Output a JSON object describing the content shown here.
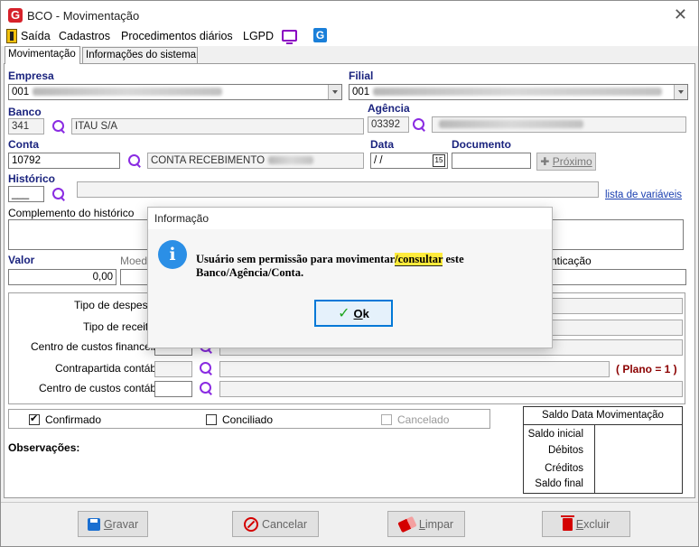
{
  "window": {
    "title": "BCO - Movimentação",
    "logo_letter": "G",
    "close_glyph": "✕"
  },
  "menu": {
    "items": [
      "Saída",
      "Cadastros",
      "Procedimentos diários",
      "LGPD"
    ],
    "g_badge": "G"
  },
  "tabs": [
    {
      "label": "Movimentação"
    },
    {
      "label": "Informações do sistema"
    }
  ],
  "form": {
    "empresa_label": "Empresa",
    "empresa_value": "001",
    "filial_label": "Filial",
    "filial_value": "001",
    "banco_label": "Banco",
    "banco_code": "341",
    "banco_name": "ITAU S/A",
    "agencia_label": "Agência",
    "agencia_code": "03392",
    "conta_label": "Conta",
    "conta_code": "10792",
    "conta_name": "CONTA RECEBIMENTO",
    "data_label": "Data",
    "data_value": "/ /",
    "cal_glyph": "15",
    "documento_label": "Documento",
    "proximo_label": "Próximo",
    "historico_label": "Histórico",
    "historico_code": "___",
    "variables_link": "lista de variáveis",
    "complemento_label": "Complemento do histórico",
    "valor_label": "Valor",
    "valor_value": "0,00",
    "moeda_label": "Moeda",
    "autenticacao_label": "nticação",
    "tipo_despesa_label": "Tipo de despesa",
    "tipo_receita_label": "Tipo de receita",
    "centro_custos_fin_label": "Centro de custos financeiro",
    "contrapartida_label": "Contrapartida contábil",
    "plano_label": "( Plano = 1 )",
    "centro_custos_cont_label": "Centro de custos contábil",
    "confirmado_label": "Confirmado",
    "conciliado_label": "Conciliado",
    "cancelado_label": "Cancelado",
    "observacoes_label": "Observações:"
  },
  "saldo": {
    "title": "Saldo Data Movimentação",
    "rows": [
      "Saldo inicial",
      "Débitos",
      "Créditos",
      "Saldo final"
    ]
  },
  "footer": {
    "gravar_first": "G",
    "gravar_rest": "ravar",
    "cancelar": "Cancelar",
    "limpar_first": "L",
    "limpar_rest": "impar",
    "excluir_first": "E",
    "excluir_rest": "xcluir"
  },
  "dialog": {
    "title": "Informação",
    "icon_glyph": "i",
    "message_part1": "Usuário sem permissão para movimentar",
    "message_highlight": "/consultar",
    "message_part2": " este",
    "message_line2": "Banco/Agência/Conta.",
    "ok_first": "O",
    "ok_rest": "k",
    "ok_check": "✓"
  },
  "colors": {
    "accent": "#1a237e",
    "link": "#1a3fb0",
    "plano": "#8b0000",
    "dialog_accent": "#0078d7",
    "info_icon": "#2b8fe6"
  }
}
